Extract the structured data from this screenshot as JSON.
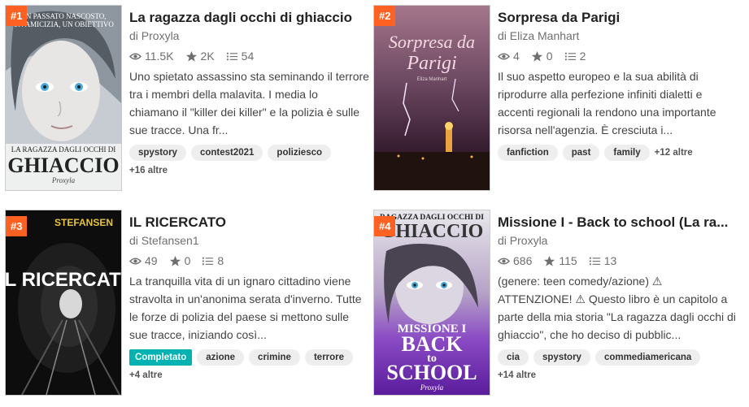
{
  "stories": [
    {
      "rank": "#1",
      "title": "La ragazza dagli occhi di ghiaccio",
      "author": "di Proxyla",
      "reads": "11.5K",
      "votes": "2K",
      "parts": "54",
      "description": "Uno spietato assassino sta seminando il terrore tra i membri della malavita. I media lo chiamano il \"killer dei killer\" e la polizia è sulle sue tracce. Una fr...",
      "tags": [
        "spystory",
        "contest2021",
        "poliziesco"
      ],
      "more": "+16 altre",
      "cover": {
        "top": "UN PASSATO NASCOSTO, UN'AMICIZIA, UN OBIETTIVO",
        "line1": "LA RAGAZZA DAGLI OCCHI DI",
        "line2": "GHIACCIO",
        "sign": "Proxyla"
      }
    },
    {
      "rank": "#2",
      "title": "Sorpresa da Parigi",
      "author": "di Eliza Manhart",
      "reads": "4",
      "votes": "0",
      "parts": "2",
      "description": "Il suo aspetto europeo e la sua abilità di riprodurre alla perfezione infiniti dialetti e accenti regionali la rendono una importante risorsa nell'agenzia. È cresciuta i...",
      "tags": [
        "fanfiction",
        "past",
        "family"
      ],
      "more": "+12 altre",
      "cover": {
        "line1": "Sorpresa da",
        "line2": "Parigi",
        "sign": "Eliza Manhart"
      }
    },
    {
      "rank": "#3",
      "title": "IL RICERCATO",
      "author": "di Stefansen1",
      "reads": "49",
      "votes": "0",
      "parts": "8",
      "description": "La tranquilla vita di un ignaro cittadino viene stravolta in un'anonima serata d'inverno. Tutte le forze di polizia del paese si mettono sulle sue tracce, iniziando così...",
      "completed": "Completato",
      "tags": [
        "azione",
        "crimine",
        "terrore"
      ],
      "more": "+4 altre",
      "cover": {
        "top": "STEFANSEN",
        "line1": "IL RICERCATO"
      }
    },
    {
      "rank": "#4",
      "title": "Missione I - Back to school (La ra...",
      "author": "di Proxyla",
      "reads": "686",
      "votes": "115",
      "parts": "13",
      "description": "(genere: teen comedy/azione) ⚠ ATTENZIONE! ⚠ Questo libro è un capitolo a parte della mia storia \"La ragazza dagli occhi di ghiaccio\", che ho deciso di pubblic...",
      "tags": [
        "cia",
        "spystory",
        "commediamericana"
      ],
      "more": "+14 altre",
      "cover": {
        "line1": "RAGAZZA DAGLI OCCHI DI",
        "line2": "GHIACCIO",
        "line3": "MISSIONE I",
        "line4": "BACK",
        "line5": "to",
        "line6": "SCHOOL",
        "sign": "Proxyla"
      }
    }
  ]
}
